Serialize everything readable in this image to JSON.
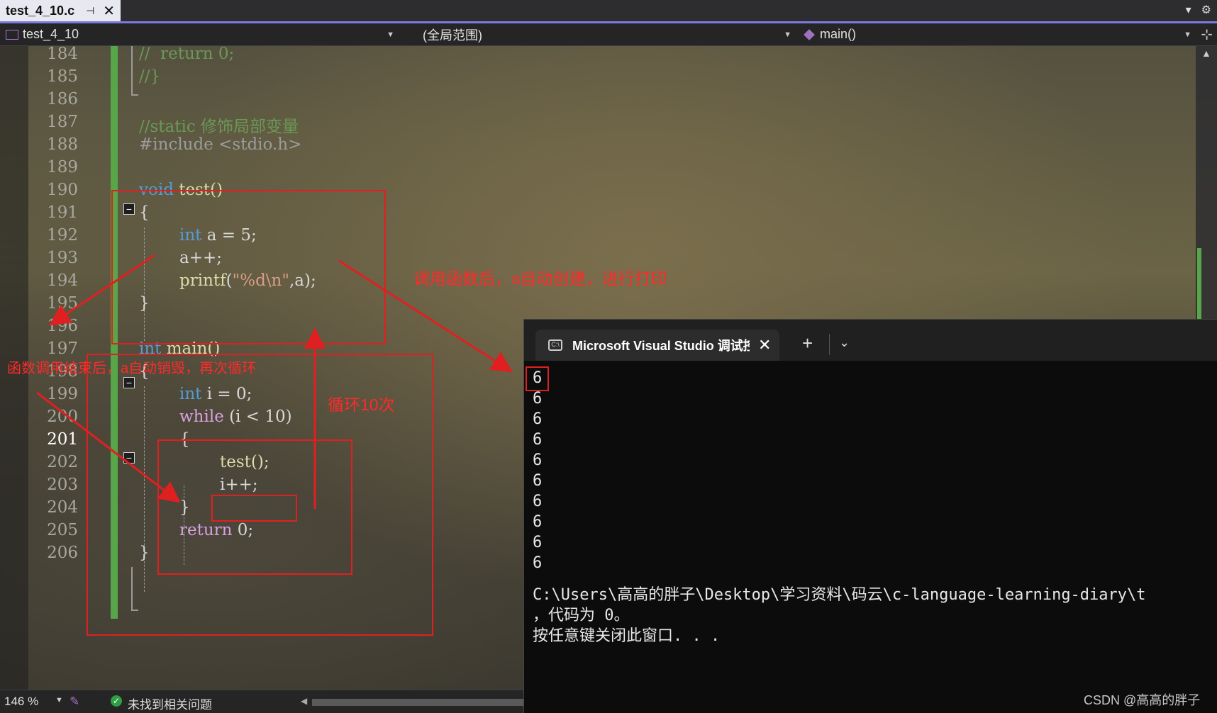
{
  "tab": {
    "title": "test_4_10.c",
    "pin": "⊣",
    "close": "✕"
  },
  "titlebar_icons": {
    "dropdown": "▾",
    "settings": "⚙"
  },
  "nav": {
    "project": "test_4_10",
    "scope": "(全局范围)",
    "member": "main()"
  },
  "editor": {
    "current_line": "201",
    "lines": [
      {
        "n": "184"
      },
      {
        "n": "185"
      },
      {
        "n": "186"
      },
      {
        "n": "187"
      },
      {
        "n": "188"
      },
      {
        "n": "189"
      },
      {
        "n": "190"
      },
      {
        "n": "191"
      },
      {
        "n": "192"
      },
      {
        "n": "193"
      },
      {
        "n": "194"
      },
      {
        "n": "195"
      },
      {
        "n": "196"
      },
      {
        "n": "197"
      },
      {
        "n": "198"
      },
      {
        "n": "199"
      },
      {
        "n": "200"
      },
      {
        "n": "201"
      },
      {
        "n": "202"
      },
      {
        "n": "203"
      },
      {
        "n": "204"
      },
      {
        "n": "205"
      },
      {
        "n": "206"
      }
    ],
    "code": {
      "l184_comment": "//  return 0;",
      "l185_comment": "//}",
      "l187_comment": "//static 修饰局部变量",
      "l188_include": "#include <stdio.h>",
      "l190_void": "void",
      "l190_name": " test()",
      "l191": "{",
      "l192_int": "int",
      "l192_rest": " a = 5;",
      "l193": "a++;",
      "l194_fn": "printf",
      "l194_open": "(",
      "l194_str": "\"%d\\n\"",
      "l194_rest": ",a);",
      "l195": "}",
      "l197_int": "int",
      "l197_name": " main()",
      "l198": "{",
      "l199_int": "int",
      "l199_rest": " i = 0;",
      "l200_while": "while",
      "l200_rest": " (i < 10)",
      "l201": "{",
      "l202": "test();",
      "l203": "i++;",
      "l204": "}",
      "l205_return": "return",
      "l205_rest": " 0;",
      "l206": "}"
    }
  },
  "annotations": {
    "create_print": "调用函数后，a自动创建，进行打印",
    "destroy_loop": "函数调用结束后，a自动销毁，再次循环",
    "loop_10": "循环10次"
  },
  "terminal": {
    "title": "Microsoft Visual Studio 调试控制台",
    "icon": "C:\\",
    "close": "✕",
    "new_tab": "+",
    "dropdown": "⌄",
    "outputs": [
      "6",
      "6",
      "6",
      "6",
      "6",
      "6",
      "6",
      "6",
      "6",
      "6"
    ],
    "path_line": "C:\\Users\\高高的胖子\\Desktop\\学习资料\\码云\\c-language-learning-diary\\t",
    "exit_line": "，代码为 0。",
    "press_key": "按任意键关闭此窗口. . ."
  },
  "status": {
    "zoom": "146 %",
    "issues": "未找到相关问题"
  },
  "watermark": "CSDN @高高的胖子",
  "colors": {
    "annotation": "#e02020",
    "change_bar": "#57a64a",
    "keyword": "#569cd6",
    "comment": "#6a9955"
  }
}
